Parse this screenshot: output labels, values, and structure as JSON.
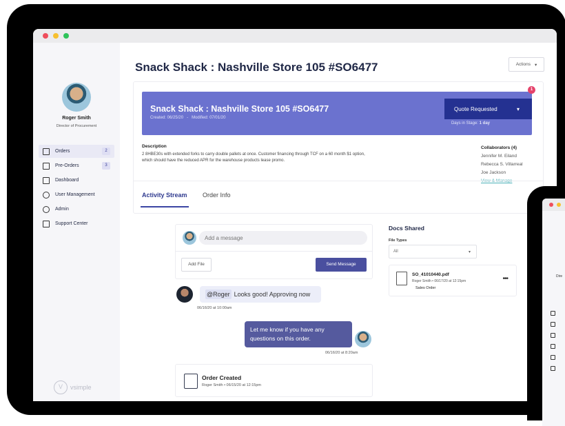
{
  "page": {
    "title": "Snack Shack : Nashville Store 105 #SO6477",
    "actions_label": "Actions"
  },
  "user": {
    "name": "Roger Smith",
    "role": "Director of Procurement"
  },
  "sidebar": {
    "items": [
      {
        "label": "Orders",
        "badge": "2",
        "icon": "orders-icon"
      },
      {
        "label": "Pre-Orders",
        "badge": "3",
        "icon": "preorders-icon"
      },
      {
        "label": "Dashboard",
        "icon": "dashboard-icon"
      },
      {
        "label": "User Management",
        "icon": "users-icon"
      },
      {
        "label": "Admin",
        "icon": "gear-icon"
      },
      {
        "label": "Support Center",
        "icon": "book-icon"
      }
    ],
    "brand": "vsimple"
  },
  "order": {
    "title": "Snack Shack : Nashville Store 105 #SO6477",
    "created": "Created: 06/25/20",
    "separator": "-",
    "modified": "Modified: 07/01/20",
    "status": "Quote Requested",
    "days_in_stage_label": "Days in Stage:",
    "days_in_stage_value": "1 day",
    "notification_count": "1",
    "description_label": "Description",
    "description": "2 8HBE30s with extended forks to carry double pallets at once. Customer financing through TCF on a 60 month $1 option, which should have the reduced APR for the warehouse products lease promo.",
    "collaborators_title": "Collaborators (4)",
    "collaborators": [
      "Jennifer M. Eiland",
      "Rebecca S. Villarreal",
      "Joe Jackson"
    ],
    "view_manage": "View & Manage"
  },
  "tabs": [
    {
      "label": "Activity Stream"
    },
    {
      "label": "Order Info"
    }
  ],
  "composer": {
    "placeholder": "Add a message",
    "add_file": "Add File",
    "send": "Send Message"
  },
  "messages": [
    {
      "mention": "@Roger",
      "text": "Looks good! Approving now",
      "time": "06/16/20 at 10:00am"
    },
    {
      "text": "Let me know if you have any questions on this order.",
      "time": "06/16/20 at 8:20am"
    }
  ],
  "event": {
    "title": "Order Created",
    "meta": "Roger Smith • 06/15/20 at 12:15pm"
  },
  "docs": {
    "title": "Docs Shared",
    "file_types_label": "File Types",
    "file_types_value": "All",
    "file": {
      "name": "SO_41010440.pdf",
      "meta": "Roger Smith • 06/17/20 at 12:15pm",
      "type": "Sales Order"
    }
  },
  "device2": {
    "text": "Dire"
  },
  "colors": {
    "banner": "#6b72cf",
    "status_button": "#243191",
    "accent": "#4a4f9f",
    "link": "#4db1b8",
    "badge": "#e5436b"
  }
}
